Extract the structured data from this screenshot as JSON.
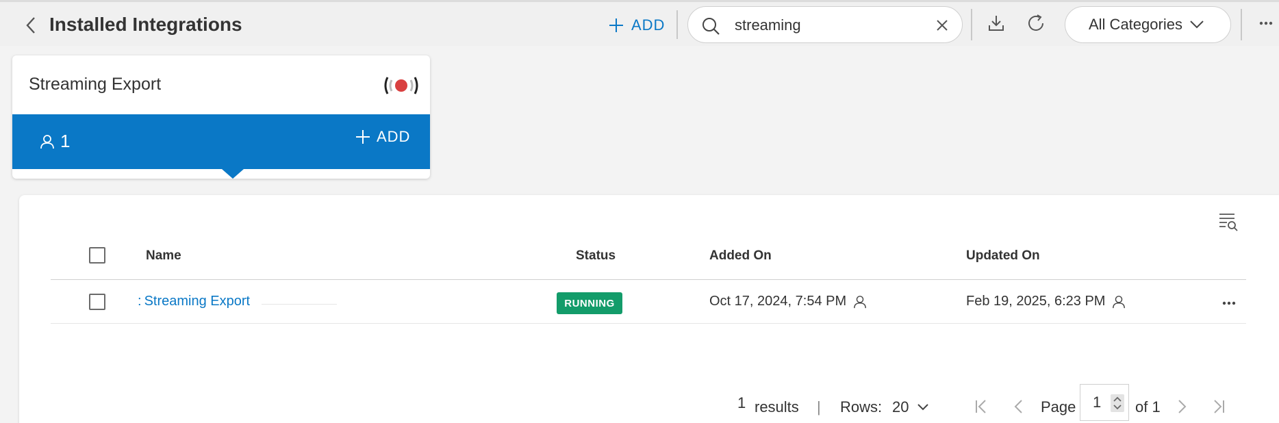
{
  "header": {
    "title": "Installed Integrations",
    "add_label": "ADD",
    "search": {
      "value": "streaming",
      "placeholder": ""
    },
    "category_select": "All Categories"
  },
  "card": {
    "title": "Streaming Export",
    "user_count": "1",
    "add_label": "ADD",
    "accent_color": "#0a78c6",
    "status_color": "#d94040"
  },
  "table": {
    "columns": [
      "Name",
      "Status",
      "Added On",
      "Updated On"
    ],
    "rows": [
      {
        "name_prefix": ":",
        "name": "Streaming Export",
        "status": "RUNNING",
        "added_on": "Oct 17, 2024, 7:54 PM",
        "updated_on": "Feb 19, 2025, 6:23 PM"
      }
    ],
    "status_color": "#139c6a"
  },
  "pagination": {
    "results_count": "1",
    "results_label": "results",
    "separator": "|",
    "rows_label": "Rows:",
    "rows_value": "20",
    "page_label": "Page",
    "page_value": "1",
    "of_label": "of 1"
  }
}
